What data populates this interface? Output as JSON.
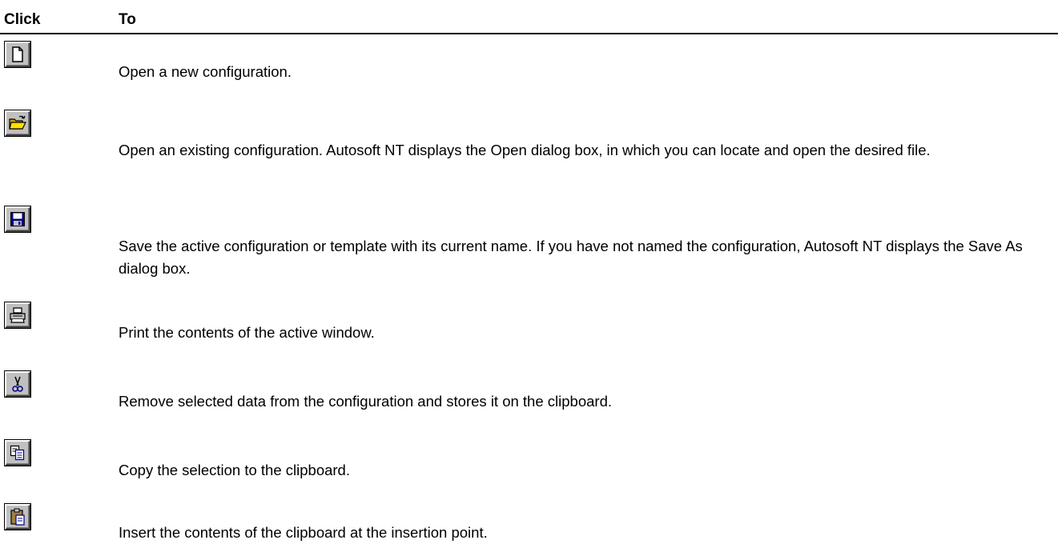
{
  "header": {
    "click": "Click",
    "to": "To"
  },
  "rows": [
    {
      "icon": "new-document-icon",
      "text": "Open a new configuration."
    },
    {
      "icon": "open-folder-icon",
      "text": "Open an existing configuration.  Autosoft NT displays the Open dialog box, in which you can locate and open the desired file."
    },
    {
      "icon": "save-disk-icon",
      "text": "Save the active configuration or template with its current name.  If you have not named the configuration, Autosoft NT displays the Save As dialog box."
    },
    {
      "icon": "print-icon",
      "text": "Print the contents of the active window."
    },
    {
      "icon": "cut-scissors-icon",
      "text": "Remove selected data from the configuration and stores it on the clipboard."
    },
    {
      "icon": "copy-icon",
      "text": "Copy the selection to the clipboard."
    },
    {
      "icon": "paste-icon",
      "text": "Insert the contents of the clipboard at the insertion point."
    }
  ]
}
